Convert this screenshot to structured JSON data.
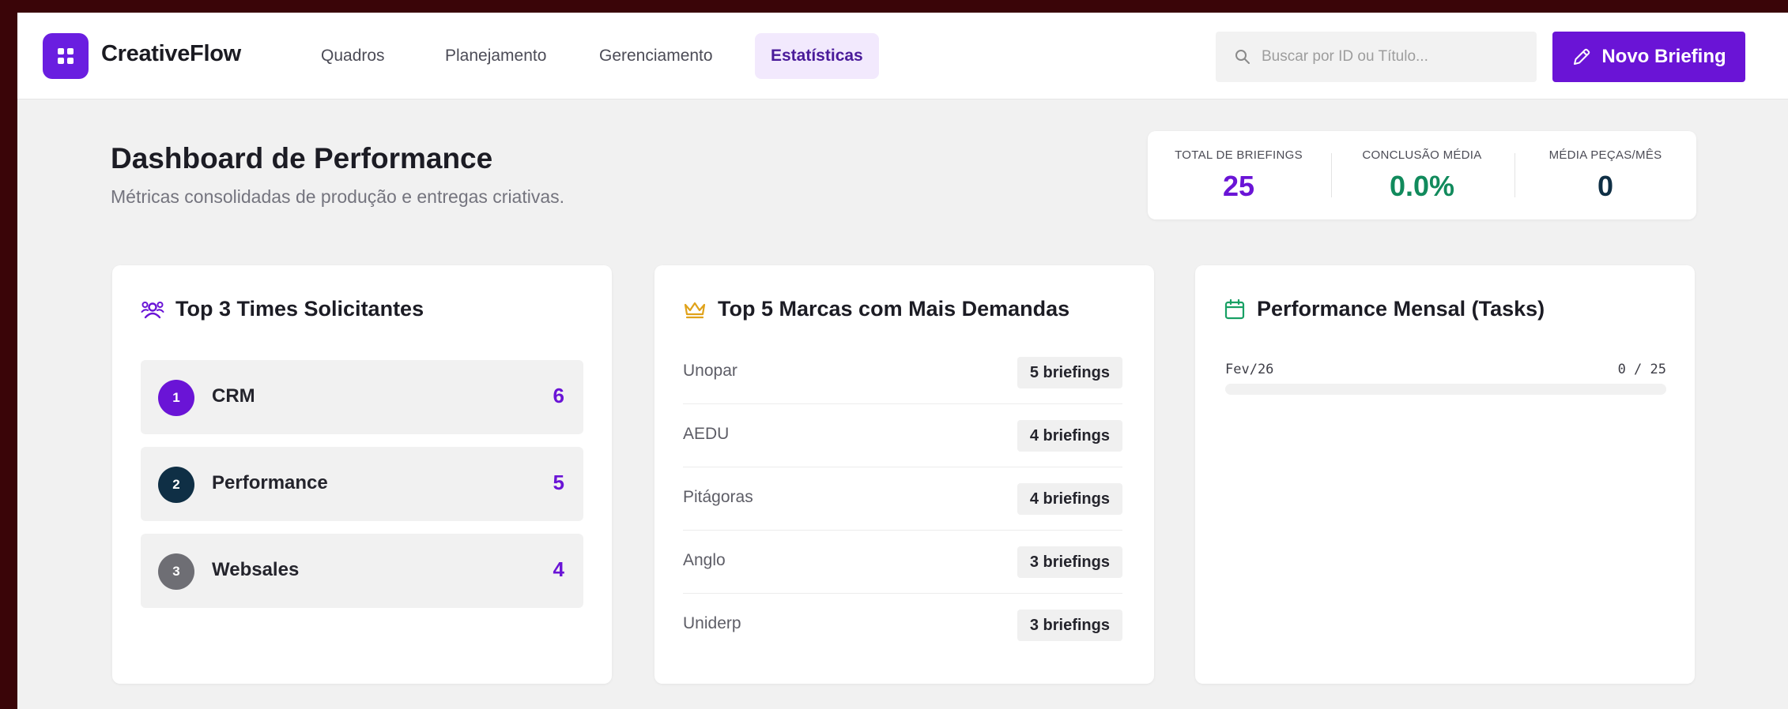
{
  "header": {
    "brand": "CreativeFlow",
    "nav": [
      {
        "label": "Quadros",
        "active": false
      },
      {
        "label": "Planejamento",
        "active": false
      },
      {
        "label": "Gerenciamento",
        "active": false
      },
      {
        "label": "Estatísticas",
        "active": true
      }
    ],
    "search_placeholder": "Buscar por ID ou Título...",
    "new_button_label": "Novo Briefing",
    "logo_icon": "grid-icon",
    "search_icon": "search-icon",
    "pencil_icon": "pencil-icon"
  },
  "dashboard": {
    "title": "Dashboard de Performance",
    "subtitle": "Métricas consolidadas de produção e entregas criativas."
  },
  "stats": [
    {
      "label": "TOTAL DE BRIEFINGS",
      "value": "25",
      "color": "#6a14d6"
    },
    {
      "label": "CONCLUSÃO MÉDIA",
      "value": "0.0%",
      "color": "#118a5c"
    },
    {
      "label": "MÉDIA PEÇAS/MÊS",
      "value": "0",
      "color": "#0f2f45"
    }
  ],
  "teams": {
    "title": "Top 3 Times Solicitantes",
    "icon": "users-icon",
    "items": [
      {
        "rank": "1",
        "name": "CRM",
        "count": "6",
        "color": "#6a14d6"
      },
      {
        "rank": "2",
        "name": "Performance",
        "count": "5",
        "color": "#0f2f45"
      },
      {
        "rank": "3",
        "name": "Websales",
        "count": "4",
        "color": "#6e6e74"
      }
    ]
  },
  "brands": {
    "title": "Top 5 Marcas com Mais Demandas",
    "icon": "crown-icon",
    "items": [
      {
        "name": "Unopar",
        "count": "5 briefings"
      },
      {
        "name": "AEDU",
        "count": "4 briefings"
      },
      {
        "name": "Pitágoras",
        "count": "4 briefings"
      },
      {
        "name": "Anglo",
        "count": "3 briefings"
      },
      {
        "name": "Uniderp",
        "count": "3 briefings"
      }
    ]
  },
  "monthly": {
    "title": "Performance Mensal (Tasks)",
    "icon": "calendar-icon",
    "items": [
      {
        "month": "Fev/26",
        "value": "0 / 25",
        "done": 0,
        "total": 25
      }
    ]
  },
  "colors": {
    "accent": "#6a14d6",
    "success": "#118a5c",
    "dark": "#0f2f45",
    "crown": "#e0a21a",
    "calendar": "#18a064"
  }
}
